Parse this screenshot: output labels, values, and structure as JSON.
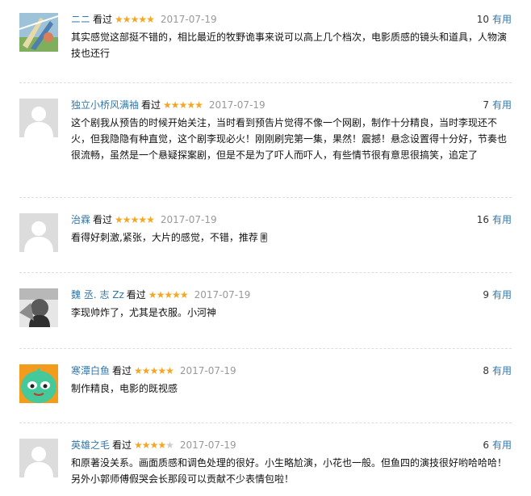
{
  "comments": [
    {
      "user": "ニニ",
      "watched_label": "看过",
      "rating": 5,
      "date": "2017-07-19",
      "votes": "10",
      "useful_label": "有用",
      "text": "其实感觉这部挺不错的，相比最近的牧野诡事来说可以高上几个档次，电影质感的镜头和道具，人物演技也还行",
      "avatar": "illustration-avatar"
    },
    {
      "user": "独立小桥风满袖",
      "watched_label": "看过",
      "rating": 5,
      "date": "2017-07-19",
      "votes": "7",
      "useful_label": "有用",
      "text": "这个剧我从预告的时候开始关注，当时看到预告片觉得不像一个网剧，制作十分精良，当时李现还不火，但我隐隐有种直觉，这个剧李现必火！刚刚刷完第一集，果然！震撼！悬念设置得十分好，节奏也很流畅，虽然是一个悬疑探案剧，但是不是为了吓人而吓人，有些情节很有意思很搞笑，追定了",
      "avatar": "default-avatar"
    },
    {
      "user": "治霖",
      "watched_label": "看过",
      "rating": 5,
      "date": "2017-07-19",
      "votes": "16",
      "useful_label": "有用",
      "text": "看得好刺激,紧张，大片的感觉，不错，推荐",
      "avatar": "default-avatar",
      "trailing_icon": "mobile-phone-icon"
    },
    {
      "user": "魏 丞. 志 Zz",
      "watched_label": "看过",
      "rating": 5,
      "date": "2017-07-19",
      "votes": "9",
      "useful_label": "有用",
      "text": "李现帅炸了，尤其是衣服。小河神",
      "avatar": "photo-avatar"
    },
    {
      "user": "寒潭白鱼",
      "watched_label": "看过",
      "rating": 5,
      "date": "2017-07-19",
      "votes": "8",
      "useful_label": "有用",
      "text": "制作精良，电影的既视感",
      "avatar": "green-cartoon-avatar"
    },
    {
      "user": "英雄之毛",
      "watched_label": "看过",
      "rating": 4,
      "date": "2017-07-19",
      "votes": "6",
      "useful_label": "有用",
      "text": "和原著没关系。画面质感和调色处理的很好。小生略尬演，小花也一般。但鱼四的演技很好哟哈哈哈！另外小郭师傅假哭会长那段可以贡献不少表情包啦！",
      "avatar": "default-avatar"
    }
  ],
  "colors": {
    "link": "#3377aa",
    "star": "#f5a623",
    "date": "#999999",
    "divider": "#dddddd"
  }
}
